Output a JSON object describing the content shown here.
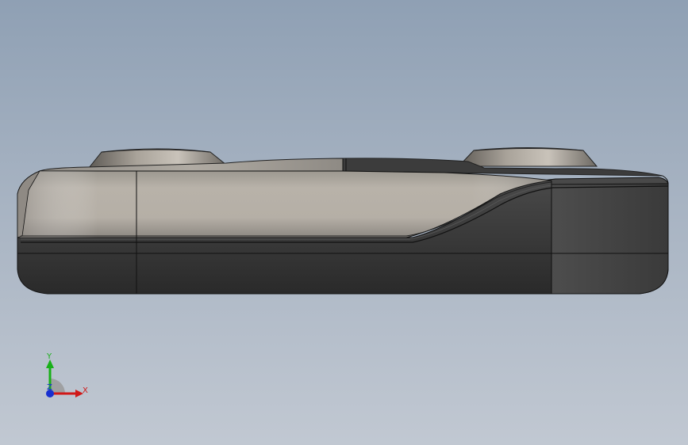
{
  "viewport": {
    "background_top": "#8fa0b4",
    "background_bottom": "#c1c8d2"
  },
  "model": {
    "body_light_color": "#b9b3aa",
    "body_dark_color": "#3a3a3a",
    "edge_color": "#111111"
  },
  "triad": {
    "x_label": "X",
    "y_label": "Y",
    "z_label": "Z",
    "x_color": "#d01818",
    "y_color": "#18b018",
    "z_color": "#1830d0"
  }
}
